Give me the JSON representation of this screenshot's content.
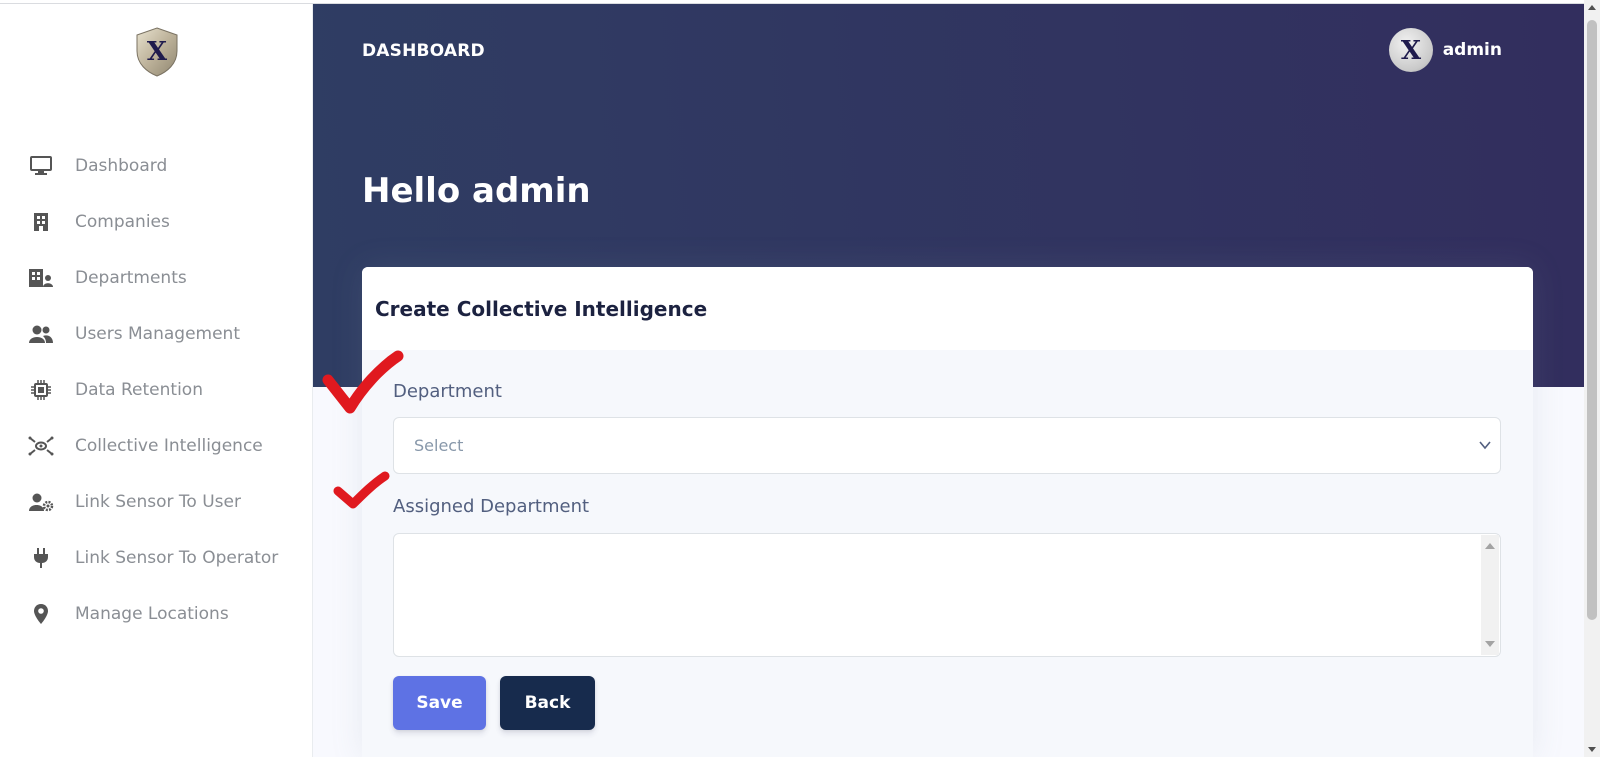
{
  "header": {
    "brand": "DASHBOARD",
    "user_name": "admin",
    "greeting": "Hello admin"
  },
  "sidebar": {
    "items": [
      {
        "label": "Dashboard",
        "icon": "desktop-icon"
      },
      {
        "label": "Companies",
        "icon": "building-icon"
      },
      {
        "label": "Departments",
        "icon": "building-user-icon"
      },
      {
        "label": "Users Management",
        "icon": "users-icon"
      },
      {
        "label": "Data Retention",
        "icon": "chip-icon"
      },
      {
        "label": "Collective Intelligence",
        "icon": "network-icon"
      },
      {
        "label": "Link Sensor To User",
        "icon": "user-cog-icon"
      },
      {
        "label": "Link Sensor To Operator",
        "icon": "plug-icon"
      },
      {
        "label": "Manage Locations",
        "icon": "map-pin-icon"
      }
    ]
  },
  "form": {
    "title": "Create Collective Intelligence",
    "department_label": "Department",
    "department_value": "Select",
    "assigned_label": "Assigned Department",
    "assigned_value": "",
    "save_label": "Save",
    "back_label": "Back"
  },
  "colors": {
    "header_gradient_start": "#2f3d63",
    "header_gradient_end": "#322e5e",
    "save_button": "#5e72e4",
    "back_button": "#172b4d",
    "checkmark": "#e0191f"
  }
}
